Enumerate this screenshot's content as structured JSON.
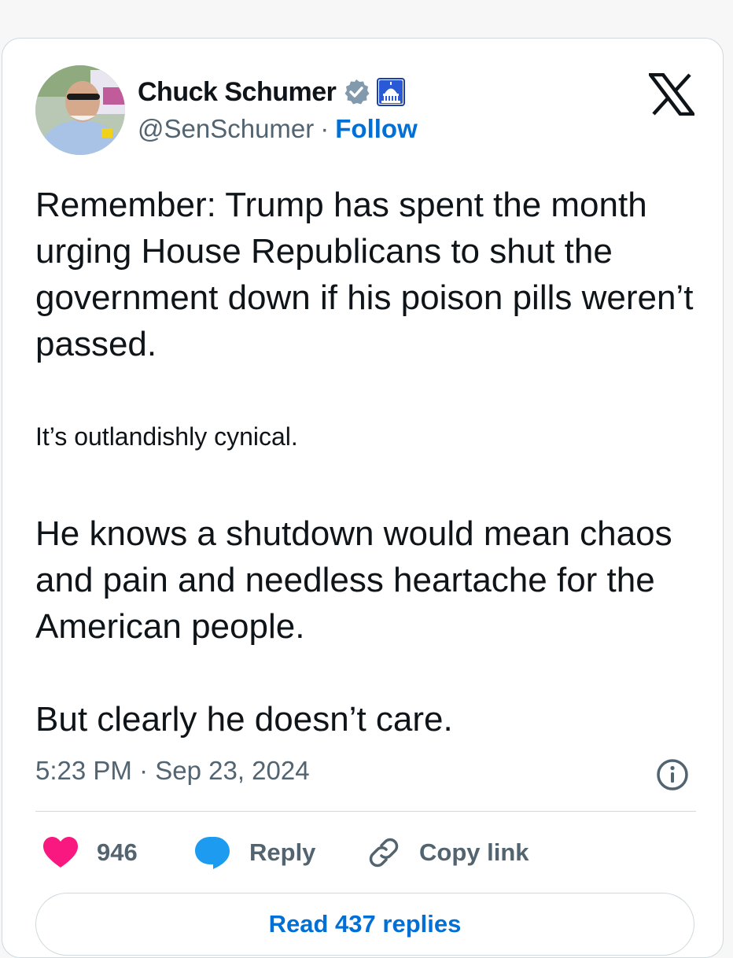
{
  "author": {
    "name": "Chuck Schumer",
    "handle": "@SenSchumer",
    "separator": "·",
    "follow_label": "Follow",
    "verified_badge_color": "#829aab",
    "affiliate_badge_color": "#1d3fa8"
  },
  "tweet": {
    "paragraphs": [
      "Remember: Trump has spent the month urging House Republicans to shut the government down if his poison pills weren’t passed.",
      "It’s outlandishly cynical.",
      "He knows a shutdown would mean chaos and pain and needless heartache for the American people.",
      "But clearly he doesn’t care."
    ],
    "timestamp": "5:23 PM · Sep 23, 2024"
  },
  "actions": {
    "like_count": "946",
    "reply_label": "Reply",
    "copy_link_label": "Copy link",
    "like_color": "#f91880",
    "reply_color": "#1d9bf0"
  },
  "footer": {
    "read_replies_label": "Read 437 replies"
  },
  "icons": {
    "platform": "x-logo-icon",
    "info": "info-icon",
    "like": "heart-icon",
    "reply": "speech-bubble-icon",
    "copy": "link-icon"
  }
}
